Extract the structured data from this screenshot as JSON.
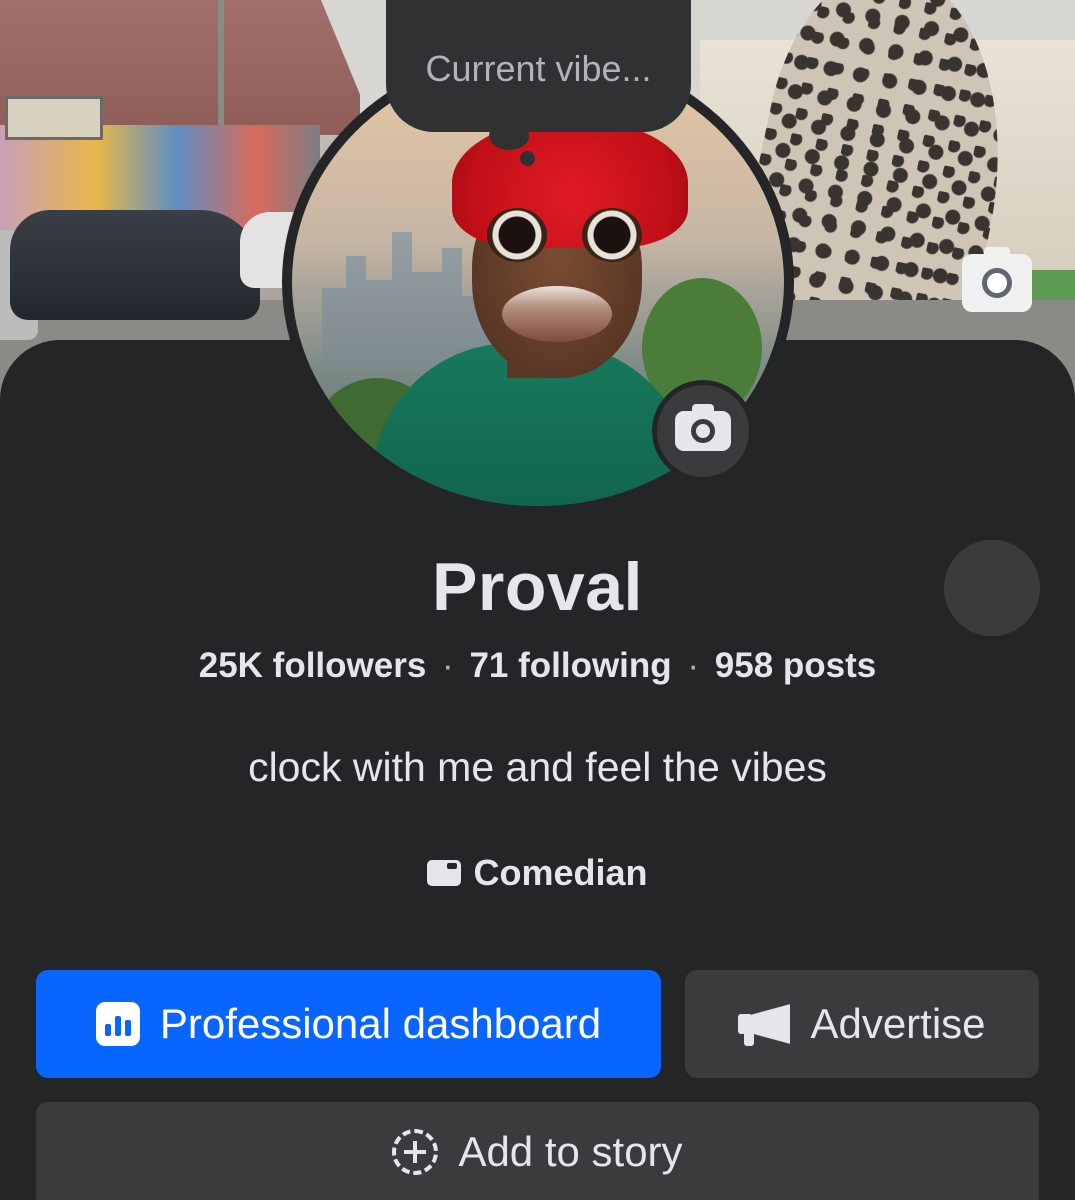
{
  "profile": {
    "vibe_placeholder": "Current vibe...",
    "name": "Proval",
    "stats": {
      "followers": "25K followers",
      "following": "71 following",
      "posts": "958 posts",
      "separator": "·"
    },
    "bio": "clock with me and feel the vibes",
    "category": "Comedian"
  },
  "actions": {
    "professional_dashboard": "Professional dashboard",
    "advertise": "Advertise",
    "add_to_story": "Add to story"
  },
  "icons": {
    "cover_camera": "camera-icon",
    "avatar_camera": "camera-icon",
    "dropdown": "chevron-down-icon",
    "category": "category-icon",
    "dashboard": "bar-chart-icon",
    "advertise": "megaphone-icon",
    "story": "add-story-icon"
  },
  "colors": {
    "background": "#242526",
    "primary_button": "#0866ff",
    "secondary_button": "#3a3b3c",
    "notification_dot": "#e41e3f",
    "text": "#e4e6eb"
  }
}
